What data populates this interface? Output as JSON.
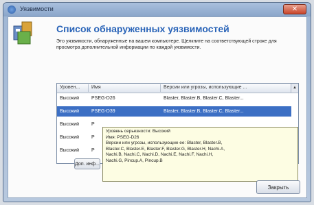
{
  "window": {
    "title": "Уязвимости",
    "close_glyph": "✕"
  },
  "heading": "Список обнаруженных уязвимостей",
  "description": "Это уязвимости, обнаруженные на вашем компьютере. Щелкните на соответствующей строке для просмотра дополнительной информации по каждой уязвимости.",
  "table": {
    "columns": [
      "Уровен...",
      "Имя",
      "Версии или угрозы, использующие ...",
      "▲"
    ],
    "rows": [
      {
        "level": "Высокий",
        "name": "PSEG-D26",
        "versions": "Blaster, Blaster.B, Blaster.C, Blaster..."
      },
      {
        "level": "Высокий",
        "name": "PSEG-D39",
        "versions": "Blaster, Blaster.B, Blaster.C, Blaster..."
      },
      {
        "level": "Высокий",
        "name": "P",
        "versions": ""
      },
      {
        "level": "Высокий",
        "name": "P",
        "versions": ""
      },
      {
        "level": "Высокий",
        "name": "P",
        "versions": ""
      }
    ],
    "selected_index": 1
  },
  "tooltip": {
    "lines": [
      "Уровень серьезности: Высокий",
      "Имя: PSEG-D26",
      "Версии или угрозы, использующие ее: Blaster, Blaster.B,",
      "Blaster.C, Blaster.E, Blaster.F, Blaster.G, Blaster.H, Nachi.A,",
      "Nachi.B, Nachi.C, Nachi.D, Nachi.E, Nachi.F, Nachi.H,",
      "Nachi.G, Рincup.A, Рincup.B"
    ]
  },
  "buttons": {
    "left": "Доп. инф...",
    "close": "Закрыть"
  },
  "colors": {
    "accent": "#2a64b8",
    "selection": "#3c6fc4",
    "tooltip_bg": "#fdfde3"
  }
}
